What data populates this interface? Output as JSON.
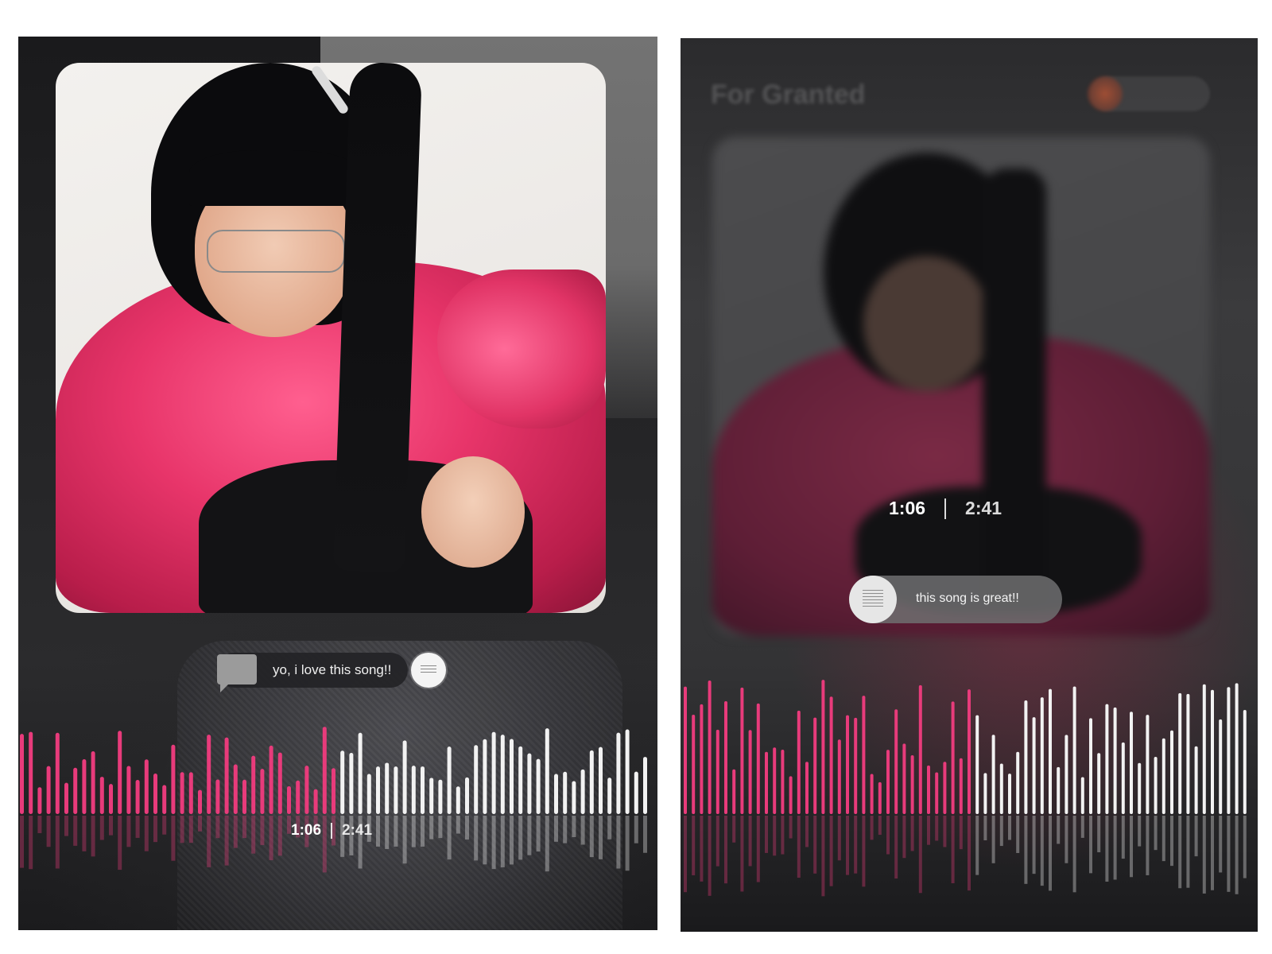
{
  "screens": [
    {
      "comment": {
        "text": "yo, i love this song!!"
      },
      "time": {
        "elapsed": "1:06",
        "total": "2:41"
      },
      "progress": 0.5
    },
    {
      "header": {
        "title": "For Granted"
      },
      "comment": {
        "text": "this song is great!!"
      },
      "time": {
        "elapsed": "1:06",
        "total": "2:41"
      },
      "progress": 0.5
    }
  ],
  "colors": {
    "played": "#e83b7b",
    "unplayed": "#f2f2f2",
    "background": "#0d0d0f"
  },
  "icons": [
    "comment-icon",
    "avatar-icon"
  ]
}
